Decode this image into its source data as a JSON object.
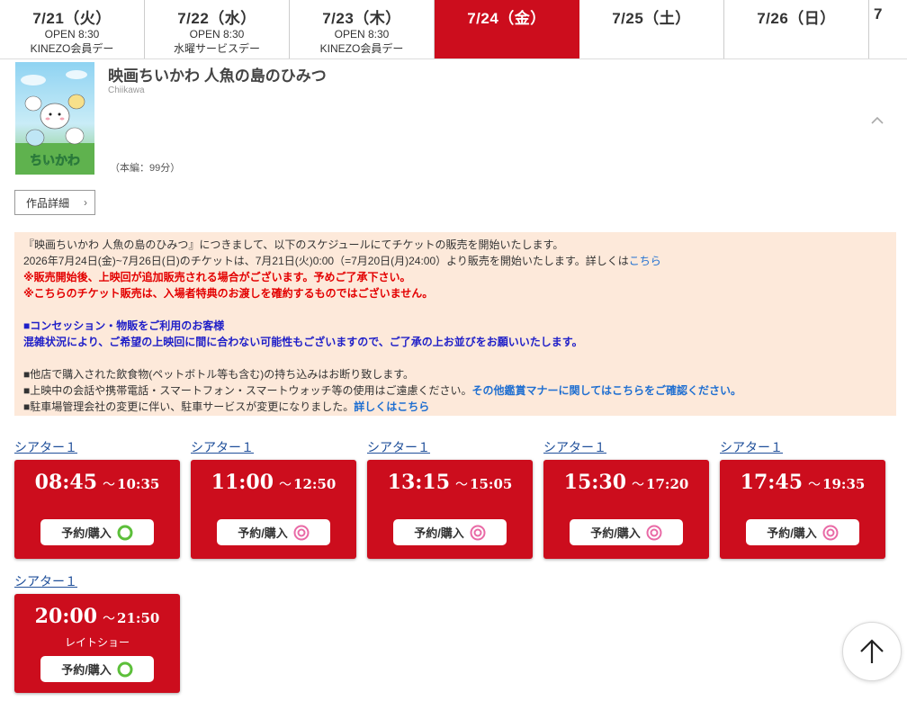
{
  "date_tabs": [
    {
      "date": "7/21（火）",
      "open": "OPEN 8:30",
      "event": "KINEZO会員デー",
      "active": false
    },
    {
      "date": "7/22（水）",
      "open": "OPEN 8:30",
      "event": "水曜サービスデー",
      "active": false
    },
    {
      "date": "7/23（木）",
      "open": "OPEN 8:30",
      "event": "KINEZO会員デー",
      "active": false
    },
    {
      "date": "7/24（金）",
      "open": "",
      "event": "",
      "active": true
    },
    {
      "date": "7/25（土）",
      "open": "",
      "event": "",
      "active": false
    },
    {
      "date": "7/26（日）",
      "open": "",
      "event": "",
      "active": false
    },
    {
      "date": "7",
      "open": "",
      "event": "",
      "active": false
    }
  ],
  "movie": {
    "title": "映画ちいかわ 人魚の島のひみつ",
    "subtitle": "Chiikawa",
    "runtime": "（本編：99分）",
    "detail_button": "作品詳細",
    "poster_logo": "ちいかわ"
  },
  "notice": {
    "l1": "『映画ちいかわ 人魚の島のひみつ』につきまして、以下のスケジュールにてチケットの販売を開始いたします。",
    "l2": "2026年7月24日(金)~7月26日(日)のチケットは、7月21日(火)0:00（=7月20日(月)24:00）より販売を開始いたします。詳しくは",
    "l2_link": "こちら",
    "l3": "※販売開始後、上映回が追加販売される場合がございます。予めご了承下さい。",
    "l4": "※こちらのチケット販売は、入場者特典のお渡しを確約するものではございません。",
    "l5": "■コンセッション・物販をご利用のお客様",
    "l6": "混雑状況により、ご希望の上映回に間に合わない可能性もございますので、ご了承の上お並びをお願いいたします。",
    "l7": "■他店で購入された飲食物(ペットボトル等も含む)の持ち込みはお断り致します。",
    "l8": "■上映中の会話や携帯電話・スマートフォン・スマートウォッチ等の使用はご遠慮ください。",
    "l8_link": "その他鑑賞マナーに関してはこちらをご確認ください。",
    "l9": "■駐車場管理会社の変更に伴い、駐車サービスが変更になりました。",
    "l9_link": "詳しくはこちら"
  },
  "showtimes": [
    {
      "theater": "シアター１",
      "start": "08:45",
      "end": "10:35",
      "tilde": "～",
      "note": "",
      "buy": "予約/購入",
      "availability": "available"
    },
    {
      "theater": "シアター１",
      "start": "11:00",
      "end": "12:50",
      "tilde": "～",
      "note": "",
      "buy": "予約/購入",
      "availability": "plenty"
    },
    {
      "theater": "シアター１",
      "start": "13:15",
      "end": "15:05",
      "tilde": "～",
      "note": "",
      "buy": "予約/購入",
      "availability": "plenty"
    },
    {
      "theater": "シアター１",
      "start": "15:30",
      "end": "17:20",
      "tilde": "～",
      "note": "",
      "buy": "予約/購入",
      "availability": "plenty"
    },
    {
      "theater": "シアター１",
      "start": "17:45",
      "end": "19:35",
      "tilde": "～",
      "note": "",
      "buy": "予約/購入",
      "availability": "plenty"
    },
    {
      "theater": "シアター１",
      "start": "20:00",
      "end": "21:50",
      "tilde": "～",
      "note": "レイトショー",
      "buy": "予約/購入",
      "availability": "available"
    }
  ],
  "colors": {
    "accent": "#cc0d1d",
    "notice_bg": "#fde9da",
    "mark_green": "#5cbf3a",
    "mark_pink": "#e96aa6"
  }
}
